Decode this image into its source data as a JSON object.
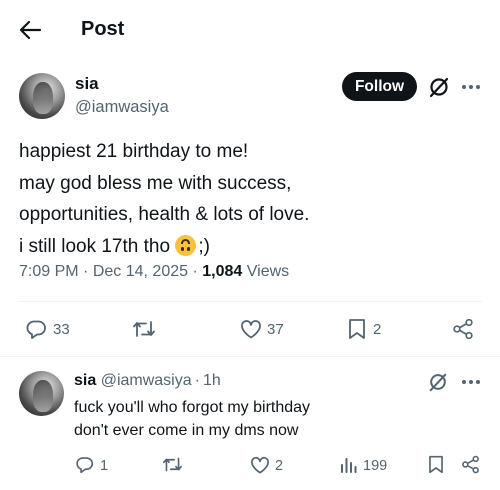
{
  "header": {
    "title": "Post"
  },
  "post": {
    "author_name": "sia",
    "handle": "@iamwasiya",
    "follow_label": "Follow",
    "lines": [
      "happiest 21 birthday to me!",
      "may god bless me with success,",
      "opportunities, health & lots of love.",
      "i still look 17th tho",
      ";)"
    ],
    "emoji": "upside-down-face",
    "time": "7:09 PM",
    "date": "Dec 14, 2025",
    "views_count": "1,084",
    "views_label": "Views",
    "separator": "·",
    "actions": {
      "replies": "33",
      "likes": "37",
      "bookmarks": "2"
    }
  },
  "reply": {
    "author_name": "sia",
    "handle": "@iamwasiya",
    "time_ago": "1h",
    "separator": "·",
    "lines": [
      "fuck you'll who forgot my birthday",
      "don't ever come in my dms now"
    ],
    "actions": {
      "replies": "1",
      "likes": "2",
      "views": "199"
    }
  },
  "icons": [
    "back-arrow-icon",
    "grok-icon",
    "more-icon",
    "reply-icon",
    "repost-icon",
    "like-icon",
    "bookmark-icon",
    "share-icon",
    "views-icon"
  ],
  "colors": {
    "text": "#0f1419",
    "muted": "#536471",
    "follow_bg": "#0f1419",
    "divider": "#eff3f4"
  }
}
